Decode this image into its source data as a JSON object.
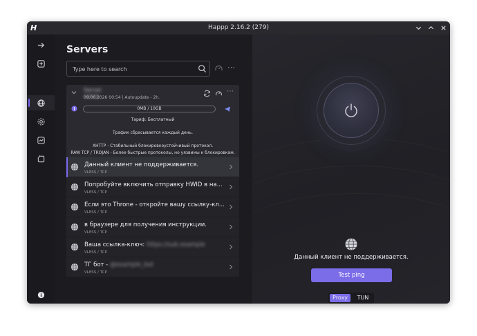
{
  "window": {
    "title": "Happp 2.16.2 (279)",
    "app_logo": "H"
  },
  "sidebar": {
    "items": [
      {
        "icon": "arrow-right-icon"
      },
      {
        "icon": "plus-square-icon"
      },
      {
        "icon": "globe-icon",
        "active": true
      },
      {
        "icon": "gear-icon"
      },
      {
        "icon": "chart-icon"
      },
      {
        "icon": "clipboard-icon"
      }
    ],
    "bottom_icon": "info-icon"
  },
  "servers": {
    "title": "Servers",
    "search_placeholder": "Type here to search",
    "subscription": {
      "name": "Server name",
      "meta": "09.06.2026 00:54 | Autoupdate - 2h.",
      "traffic": "0MB / 10GB",
      "lines": [
        "Тариф: Бесплатный",
        "Трафик сбрасывается каждый день.",
        "XHTTP - Стабильный блокировкоустойчивый протокол.",
        "RAW TCP / TROJAN - Более быстрые протоколы, но уязвимы к блокировкам."
      ]
    },
    "list": [
      {
        "name": "Данный клиент не поддерживается.",
        "extra": "",
        "protocol": "VLESS / TCP"
      },
      {
        "name": "Попробуйте включить отправку HWID в на...",
        "extra": "",
        "protocol": "VLESS / TCP"
      },
      {
        "name": "Если это Throne - откройте вашу ссылку-кл...",
        "extra": "",
        "protocol": "VLESS / TCP"
      },
      {
        "name": "в браузере для получения инструкции.",
        "extra": "",
        "protocol": "VLESS / TCP"
      },
      {
        "name": "Ваша ссылка-ключ:",
        "extra": "https://sub.example",
        "protocol": "VLESS / TCP"
      },
      {
        "name": "ТГ бот -",
        "extra": "@example_bot",
        "protocol": "VLESS / TCP"
      }
    ]
  },
  "connection": {
    "status": "Данный клиент не поддерживается.",
    "test_ping_label": "Test ping",
    "modes": [
      "Proxy",
      "TUN"
    ],
    "active_mode": "Proxy"
  },
  "colors": {
    "accent": "#7b6ce8",
    "background": "#1c1c20",
    "panel": "#2a2a30"
  }
}
